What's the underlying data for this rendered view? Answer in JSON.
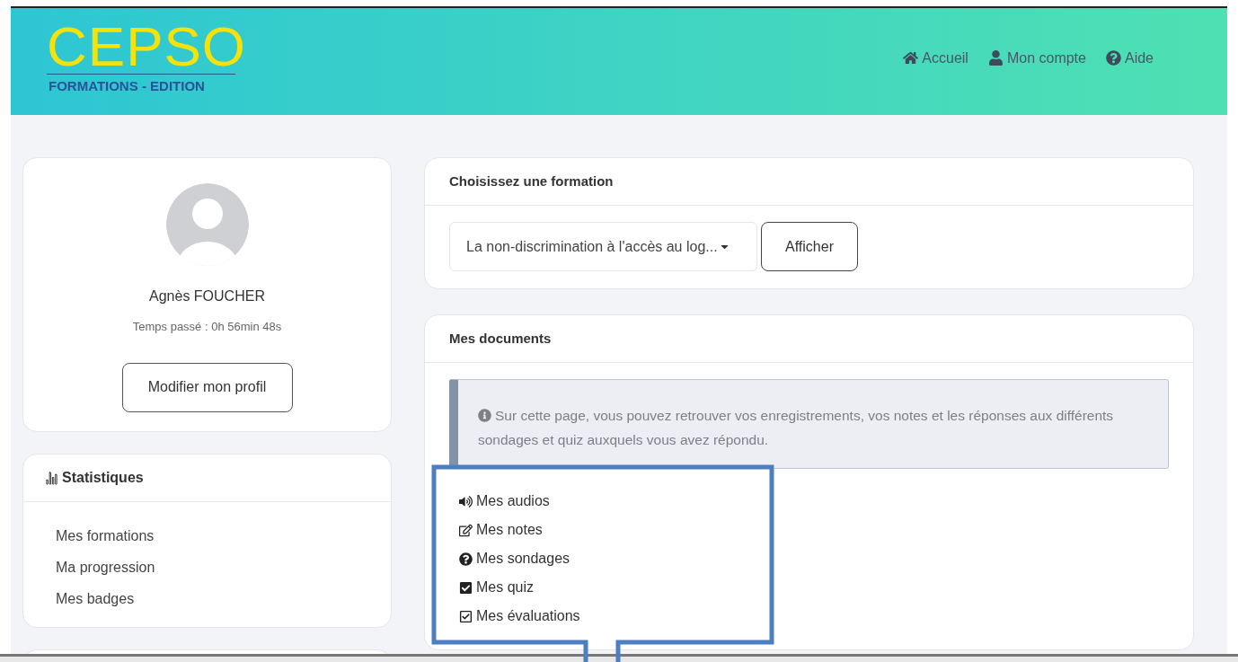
{
  "header": {
    "logo": {
      "title": "CEPSO",
      "subtitle": "FORMATIONS - EDITION"
    },
    "nav": [
      {
        "kind": "home",
        "label": "Accueil"
      },
      {
        "kind": "user",
        "label": "Mon compte"
      },
      {
        "kind": "help",
        "label": "Aide"
      }
    ]
  },
  "profile": {
    "name": "Agnès FOUCHER",
    "time_spent": "Temps passé : 0h 56min 48s",
    "button": "Modifier mon profil"
  },
  "statistics": {
    "title": "Statistiques",
    "items": [
      "Mes formations",
      "Ma progression",
      "Mes badges"
    ]
  },
  "training": {
    "title": "Choisissez une formation",
    "select_value": "La non-discrimination à l'accès au log...",
    "button": "Afficher"
  },
  "documents": {
    "title": "Mes documents",
    "info": "Sur cette page, vous pouvez retrouver vos enregistrements, vos notes et les réponses aux différents sondages et quiz auxquels vous avez répondu.",
    "items": [
      {
        "kind": "audio",
        "label": "Mes audios"
      },
      {
        "kind": "note",
        "label": "Mes notes"
      },
      {
        "kind": "question",
        "label": "Mes sondages"
      },
      {
        "kind": "checkbox",
        "label": "Mes quiz"
      },
      {
        "kind": "check",
        "label": "Mes évaluations"
      }
    ]
  }
}
